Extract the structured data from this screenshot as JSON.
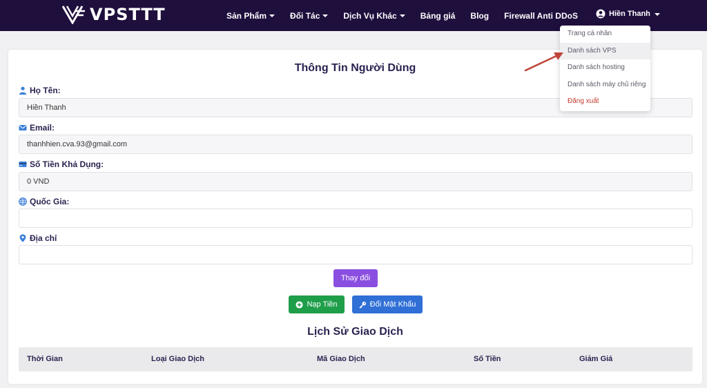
{
  "brand": {
    "name": "VPSTTT"
  },
  "nav": {
    "items": [
      {
        "label": "Sản Phẩm",
        "caret": true
      },
      {
        "label": "Đối Tác",
        "caret": true
      },
      {
        "label": "Dịch Vụ Khác",
        "caret": true
      },
      {
        "label": "Bảng giá",
        "caret": false
      },
      {
        "label": "Blog",
        "caret": false
      },
      {
        "label": "Firewall Anti DDoS",
        "caret": false
      }
    ],
    "user": {
      "name": "Hiền Thanh"
    }
  },
  "dropdown": {
    "items": [
      {
        "label": "Trang cá nhân"
      },
      {
        "label": "Danh sách VPS"
      },
      {
        "label": "Danh sách hosting"
      },
      {
        "label": "Danh sách máy chủ riêng"
      },
      {
        "label": "Đăng xuất"
      }
    ]
  },
  "profile": {
    "title": "Thông Tin Người Dùng",
    "fields": {
      "name": {
        "label": "Họ Tên:",
        "value": "Hiền Thanh"
      },
      "email": {
        "label": "Email:",
        "value": "thanhhien.cva.93@gmail.com"
      },
      "balance": {
        "label": "Số Tiền Khả Dụng:",
        "value": "0 VND"
      },
      "country": {
        "label": "Quốc Gia:",
        "value": ""
      },
      "address": {
        "label": "Địa chỉ",
        "value": ""
      }
    },
    "change_label": "Thay đổi",
    "topup_label": "Nạp Tiền",
    "change_password_label": "Đổi Mật Khẩu"
  },
  "history": {
    "title": "Lịch Sử Giao Dịch",
    "columns": [
      "Thời Gian",
      "Loại Giao Dịch",
      "Mã Giao Dịch",
      "Số Tiền",
      "Giảm Giá"
    ]
  },
  "colors": {
    "navbar": "#1f0f3d",
    "change_button": "#8a4fe0",
    "topup_button": "#1f9e4a",
    "password_button": "#2f6fd6",
    "logout": "#c0392b",
    "arrow": "#c0453a"
  }
}
